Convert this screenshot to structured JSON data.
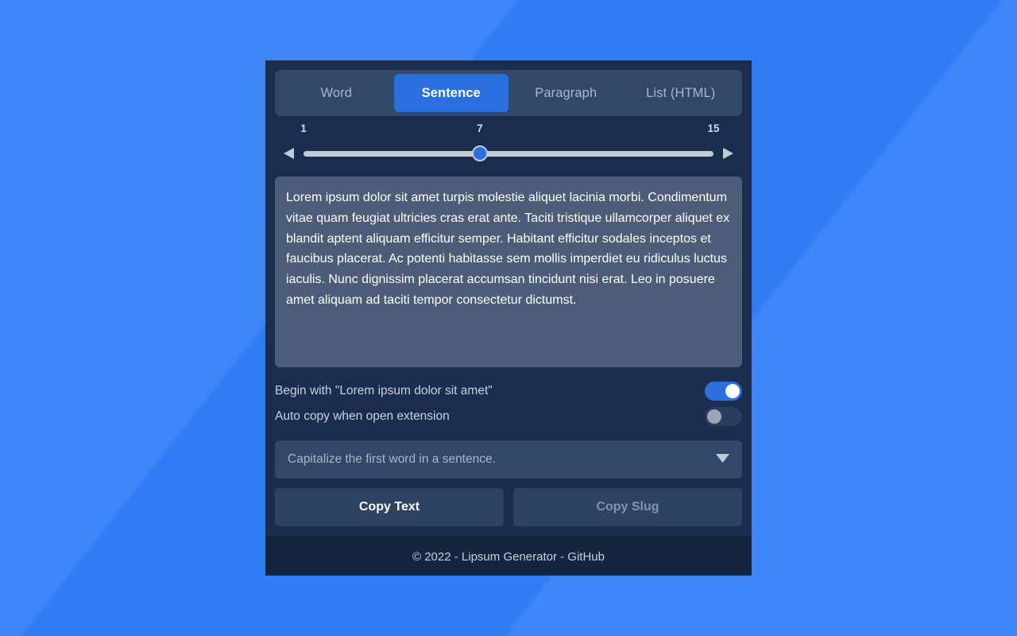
{
  "app": {
    "title": "Lipsum Generator"
  },
  "tabs": [
    {
      "label": "Word",
      "active": false
    },
    {
      "label": "Sentence",
      "active": true
    },
    {
      "label": "Paragraph",
      "active": false
    },
    {
      "label": "List (HTML)",
      "active": false
    }
  ],
  "slider": {
    "min_label": "1",
    "value_label": "7",
    "max_label": "15",
    "min": 1,
    "max": 15,
    "value": 7,
    "percent": 43,
    "decrement_icon": "triangle-left-icon",
    "increment_icon": "triangle-right-icon"
  },
  "output": {
    "text": "Lorem ipsum dolor sit amet turpis molestie aliquet lacinia morbi. Condimentum vitae quam feugiat ultricies cras erat ante. Taciti tristique ullamcorper aliquet ex blandit aptent aliquam efficitur semper. Habitant efficitur sodales inceptos et faucibus placerat. Ac potenti habitasse sem mollis imperdiet eu ridiculus luctus iaculis. Nunc dignissim placerat accumsan tincidunt nisi erat. Leo in posuere amet aliquam ad taciti tempor consectetur dictumst."
  },
  "options": [
    {
      "label": "Begin with \"Lorem ipsum dolor sit amet\"",
      "state": "on"
    },
    {
      "label": "Auto copy when open extension",
      "state": "off"
    }
  ],
  "case_select": {
    "value": "Capitalize the first word in a sentence.",
    "chevron_icon": "chevron-down-icon"
  },
  "actions": {
    "copy_text_label": "Copy Text",
    "copy_slug_label": "Copy Slug"
  },
  "footer": {
    "text": "© 2022 - Lipsum Generator - GitHub"
  },
  "colors": {
    "page_background": "#3b82f6",
    "card_background": "#1b2d4f",
    "tab_strip": "#334768",
    "accent": "#2a6fdd",
    "output_background": "#4d5d79",
    "footer_background": "#16253f",
    "muted_text": "#a9b5c9"
  }
}
